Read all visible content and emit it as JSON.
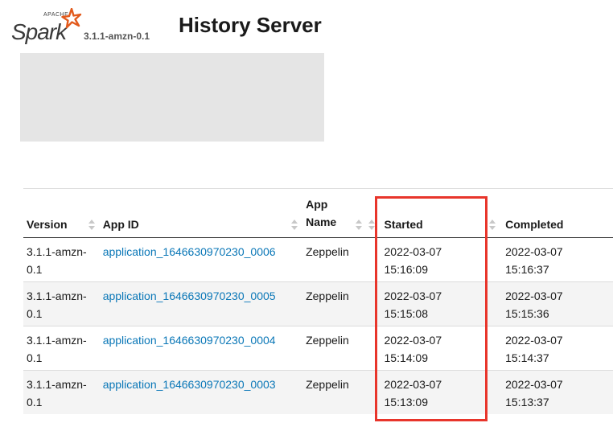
{
  "header": {
    "logo_small_text": "APACHE",
    "logo_text": "Spark",
    "version": "3.1.1-amzn-0.1",
    "title": "History Server"
  },
  "table": {
    "columns": [
      "Version",
      "App ID",
      "App Name",
      "Started",
      "Completed"
    ],
    "rows": [
      {
        "version": "3.1.1-amzn-0.1",
        "app_id": "application_1646630970230_0006",
        "app_name": "Zeppelin",
        "started": "2022-03-07 15:16:09",
        "completed": "2022-03-07 15:16:37"
      },
      {
        "version": "3.1.1-amzn-0.1",
        "app_id": "application_1646630970230_0005",
        "app_name": "Zeppelin",
        "started": "2022-03-07 15:15:08",
        "completed": "2022-03-07 15:15:36"
      },
      {
        "version": "3.1.1-amzn-0.1",
        "app_id": "application_1646630970230_0004",
        "app_name": "Zeppelin",
        "started": "2022-03-07 15:14:09",
        "completed": "2022-03-07 15:14:37"
      },
      {
        "version": "3.1.1-amzn-0.1",
        "app_id": "application_1646630970230_0003",
        "app_name": "Zeppelin",
        "started": "2022-03-07 15:13:09",
        "completed": "2022-03-07 15:13:37"
      }
    ]
  },
  "colors": {
    "link": "#0a77b7",
    "highlight": "#e8352b",
    "logo_star": "#e25a1c"
  },
  "icons": [
    "spark-logo-icon",
    "sort-icon"
  ]
}
